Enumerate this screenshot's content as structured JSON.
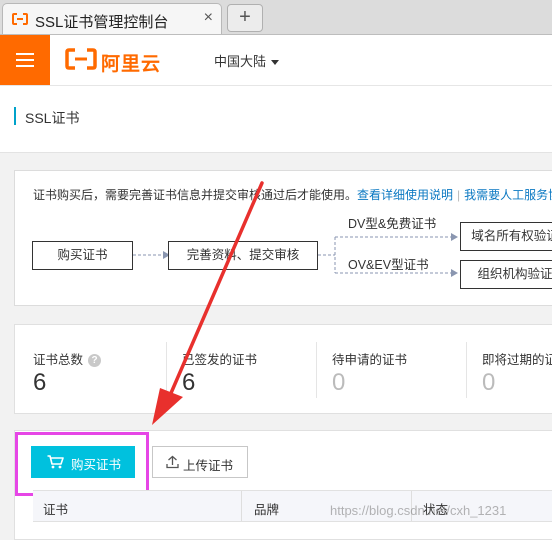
{
  "browser": {
    "tab_title": "SSL证书管理控制台",
    "tab_close": "×",
    "new_tab": "+"
  },
  "header": {
    "logo_text": "阿里云",
    "region": "中国大陆",
    "accent": "#ff6a00"
  },
  "page": {
    "title": "SSL证书"
  },
  "process": {
    "notice": "证书购买后，需要完善证书信息并提交审核通过后才能使用。",
    "link_detail": "查看详细使用说明",
    "separator": "|",
    "link_service": "我需要人工服务协",
    "steps": {
      "buy": "购买证书",
      "complete": "完善资料、提交审核",
      "dv_label": "DV型&免费证书",
      "ov_label": "OV&EV型证书",
      "domain_verify": "域名所有权验证",
      "org_verify": "组织机构验证"
    }
  },
  "stats": [
    {
      "label": "证书总数",
      "value": "6",
      "has_help": true
    },
    {
      "label": "已签发的证书",
      "value": "6"
    },
    {
      "label": "待申请的证书",
      "value": "0"
    },
    {
      "label": "即将过期的证书",
      "value": "0"
    }
  ],
  "help_glyph": "?",
  "actions": {
    "buy": "购买证书",
    "upload": "上传证书"
  },
  "table": {
    "columns": [
      "证书",
      "品牌",
      "状态"
    ]
  },
  "watermark": "https://blog.csdn.net/cxh_1231",
  "colors": {
    "primary_button": "#00c1de",
    "link": "#0a78c2",
    "highlight_box": "#e646e6",
    "annotation_arrow": "#e8302d"
  }
}
